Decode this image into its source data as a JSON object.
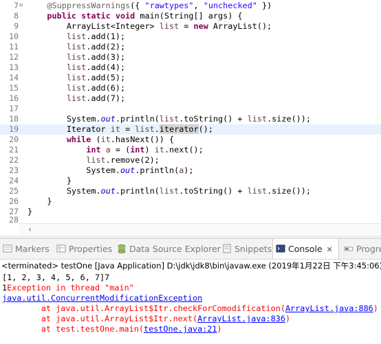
{
  "editor": {
    "line_numbers": [
      "7",
      "8",
      "9",
      "10",
      "11",
      "12",
      "13",
      "14",
      "15",
      "16",
      "17",
      "18",
      "19",
      "20",
      "21",
      "22",
      "23",
      "24",
      "25",
      "26",
      "27",
      "28"
    ],
    "fold_markers": [
      "⊖",
      "⊖"
    ]
  },
  "tabs": [
    {
      "label": "Markers"
    },
    {
      "label": "Properties"
    },
    {
      "label": "Data Source Explorer"
    },
    {
      "label": "Snippets"
    },
    {
      "label": "Console"
    },
    {
      "label": "Progre"
    }
  ],
  "console": {
    "status": "<terminated> testOne [Java Application] D:\\jdk\\jdk8\\bin\\javaw.exe (2019年1月22日 下午3:45:06)",
    "out_line": "[1, 2, 3, 4, 5, 6, 7]7",
    "err_line1_prefix": "1",
    "err_line1_rest": "Exception in thread \"main\" ",
    "exception": "java.util.ConcurrentModificationException",
    "trace": [
      {
        "prefix": "\tat java.util.ArrayList$Itr.checkForComodification(",
        "link": "ArrayList.java:886",
        "suffix": ")"
      },
      {
        "prefix": "\tat java.util.ArrayList$Itr.next(",
        "link": "ArrayList.java:836",
        "suffix": ")"
      },
      {
        "prefix": "\tat test.testOne.main(",
        "link": "testOne.java:21",
        "suffix": ")"
      }
    ]
  }
}
